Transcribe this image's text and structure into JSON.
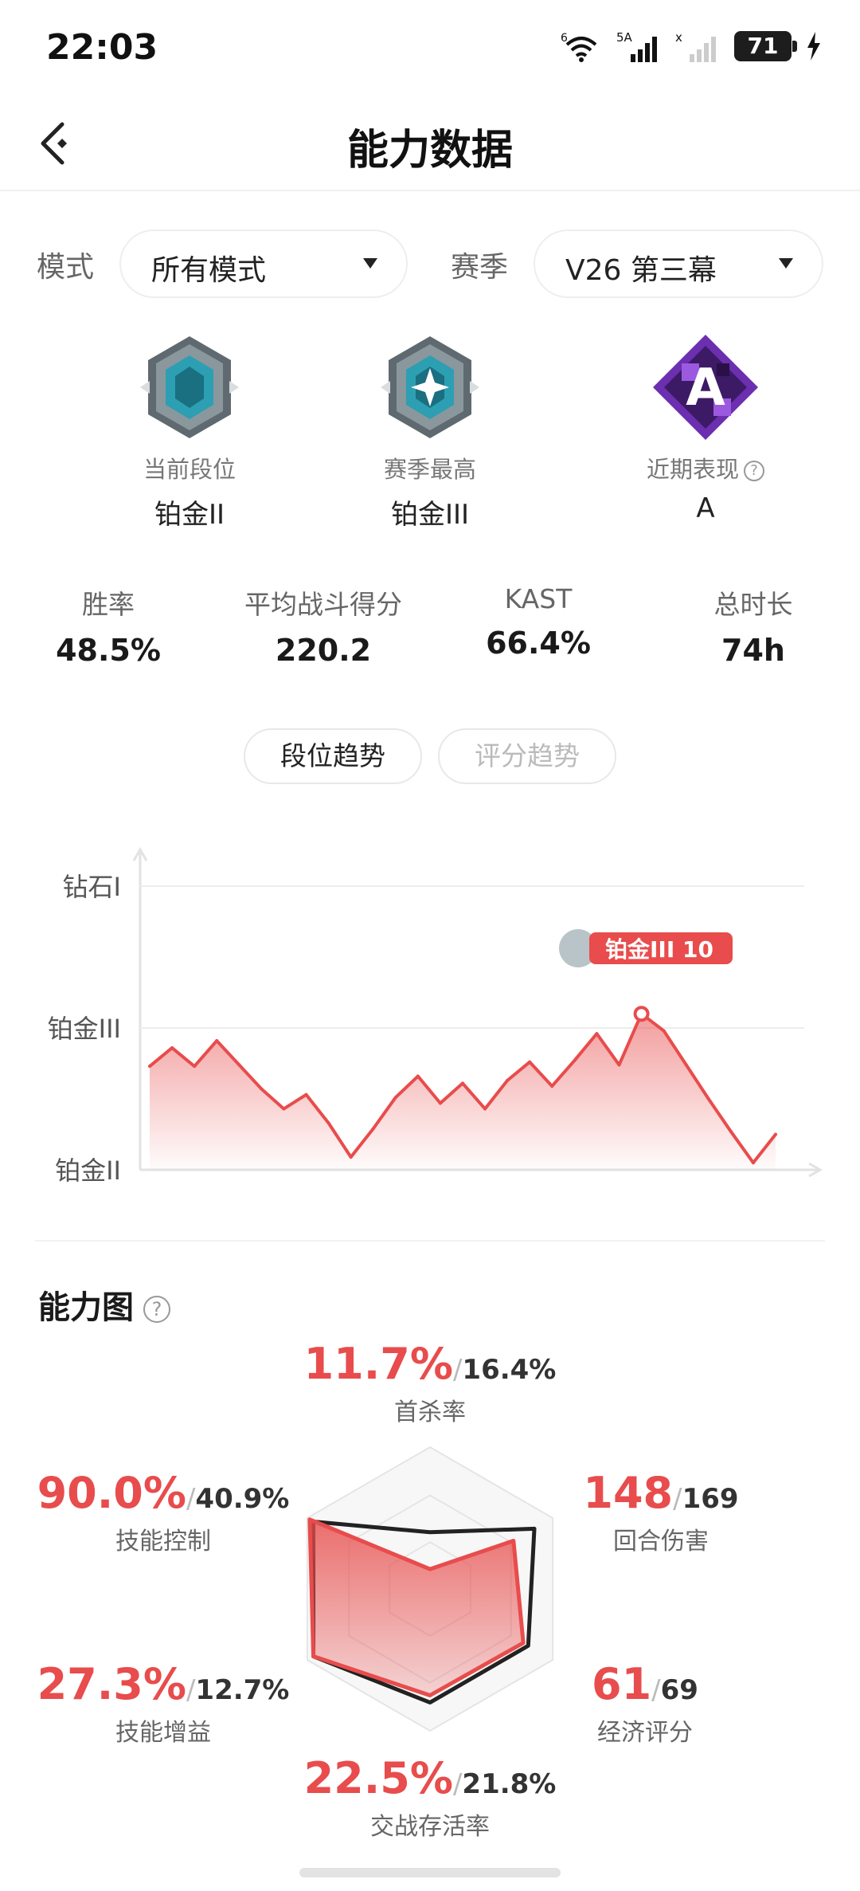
{
  "status_bar": {
    "time": "22:03",
    "battery": "71",
    "wifi_badge": "6",
    "signal1_badge": "5A",
    "signal2_badge": "x"
  },
  "header": {
    "title": "能力数据"
  },
  "filters": {
    "mode_label": "模式",
    "mode_value": "所有模式",
    "season_label": "赛季",
    "season_value": "V26 第三幕"
  },
  "ranks": [
    {
      "label": "当前段位",
      "value": "铂金II"
    },
    {
      "label": "赛季最高",
      "value": "铂金III"
    },
    {
      "label": "近期表现",
      "value": "A",
      "badge_letter": "A"
    }
  ],
  "stats": [
    {
      "label": "胜率",
      "value": "48.5%"
    },
    {
      "label": "平均战斗得分",
      "value": "220.2"
    },
    {
      "label": "KAST",
      "value": "66.4%"
    },
    {
      "label": "总时长",
      "value": "74h"
    }
  ],
  "trend_tabs": {
    "active": "段位趋势",
    "inactive": "评分趋势"
  },
  "chart_data": {
    "type": "area",
    "y_tick_labels": [
      "铂金II",
      "铂金III",
      "钻石I"
    ],
    "y_levels": [
      0,
      1,
      2
    ],
    "ylim": [
      0,
      2
    ],
    "annotation": "铂金III 10",
    "highlight_index": 22,
    "color": "#e84c4c",
    "values": [
      0.73,
      0.86,
      0.73,
      0.91,
      0.74,
      0.57,
      0.43,
      0.53,
      0.33,
      0.09,
      0.29,
      0.51,
      0.66,
      0.47,
      0.61,
      0.43,
      0.63,
      0.76,
      0.59,
      0.77,
      0.96,
      0.74,
      1.1,
      0.98,
      0.74,
      0.5,
      0.27,
      0.05,
      0.25
    ]
  },
  "ability": {
    "title": "能力图",
    "stats": [
      {
        "key": "first_kill",
        "main": "11.7%",
        "sub": "16.4%",
        "label": "首杀率"
      },
      {
        "key": "round_damage",
        "main": "148",
        "sub": "169",
        "label": "回合伤害"
      },
      {
        "key": "economy",
        "main": "61",
        "sub": "69",
        "label": "经济评分"
      },
      {
        "key": "survival",
        "main": "22.5%",
        "sub": "21.8%",
        "label": "交战存活率"
      },
      {
        "key": "skill_gain",
        "main": "27.3%",
        "sub": "12.7%",
        "label": "技能增益"
      },
      {
        "key": "skill_control",
        "main": "90.0%",
        "sub": "40.9%",
        "label": "技能控制"
      }
    ],
    "radar": {
      "axes_order": [
        "首杀率",
        "回合伤害",
        "经济评分",
        "交战存活率",
        "技能增益",
        "技能控制"
      ],
      "player_values": [
        0.14,
        0.68,
        0.76,
        0.75,
        0.95,
        0.98
      ],
      "average_values": [
        0.4,
        0.85,
        0.8,
        0.8,
        0.95,
        0.95
      ],
      "player_color": "#e84c4c",
      "average_color": "#222222"
    }
  }
}
